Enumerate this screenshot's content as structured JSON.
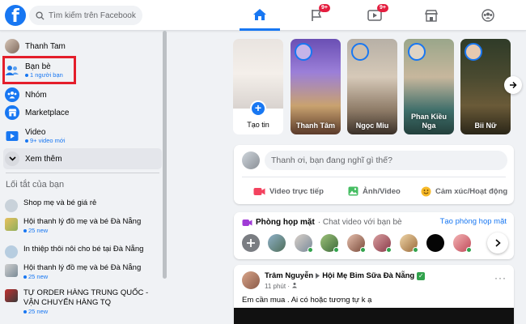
{
  "header": {
    "logo_letter": "f",
    "search_placeholder": "Tìm kiếm trên Facebook",
    "nav": [
      {
        "name": "home",
        "badge": ""
      },
      {
        "name": "pages",
        "badge": "9+"
      },
      {
        "name": "watch",
        "badge": "9+"
      },
      {
        "name": "marketplace",
        "badge": ""
      },
      {
        "name": "groups",
        "badge": ""
      }
    ]
  },
  "sidebar": {
    "user_name": "Thanh Tam",
    "friends_label": "Bạn bè",
    "friends_sub": "1 người bạn",
    "groups_label": "Nhóm",
    "marketplace_label": "Marketplace",
    "video_label": "Video",
    "video_sub": "9+ video mới",
    "see_more_label": "Xem thêm",
    "shortcuts_title": "Lối tắt của bạn",
    "shortcuts": [
      {
        "label": "Shop mẹ và bé giá rẻ",
        "sub": ""
      },
      {
        "label": "Hội thanh lý đồ mẹ và bé Đà Nẵng",
        "sub": "25 new"
      },
      {
        "label": "In thiệp thôi nôi cho bé tại Đà Nẵng",
        "sub": ""
      },
      {
        "label": "Hội thanh lý đồ mẹ và bé Đà Nẵng",
        "sub": "25 new"
      },
      {
        "label": "TỰ ORDER HÀNG TRUNG QUỐC - VẬN CHUYỂN HÀNG TQ",
        "sub": "25 new"
      }
    ]
  },
  "stories": {
    "create_label": "Tạo tin",
    "items": [
      {
        "name": "Thanh Tâm"
      },
      {
        "name": "Ngọc Miu"
      },
      {
        "name": "Phan Kiều Nga"
      },
      {
        "name": "Bii Nữ"
      }
    ]
  },
  "composer": {
    "placeholder": "Thanh ơi, bạn đang nghĩ gì thế?",
    "live_label": "Video trực tiếp",
    "photo_label": "Ảnh/Video",
    "feeling_label": "Cảm xúc/Hoạt động"
  },
  "rooms": {
    "title": "Phòng họp mặt",
    "subtitle": "· Chat video với bạn bè",
    "create_label": "Tạo phòng họp mặt"
  },
  "post": {
    "author": "Trâm Nguyễn",
    "group": "Hội Mẹ Bỉm Sữa Đà Nẵng",
    "verified_mark": "✓",
    "time": "11 phút ·",
    "dots": "···",
    "text": "Em cần mua . Ai có hoặc tương tự k ạ"
  },
  "colors": {
    "brand": "#1877f2",
    "badge": "#e41e3f",
    "highlight": "#e41e2b",
    "online": "#31a24c"
  }
}
